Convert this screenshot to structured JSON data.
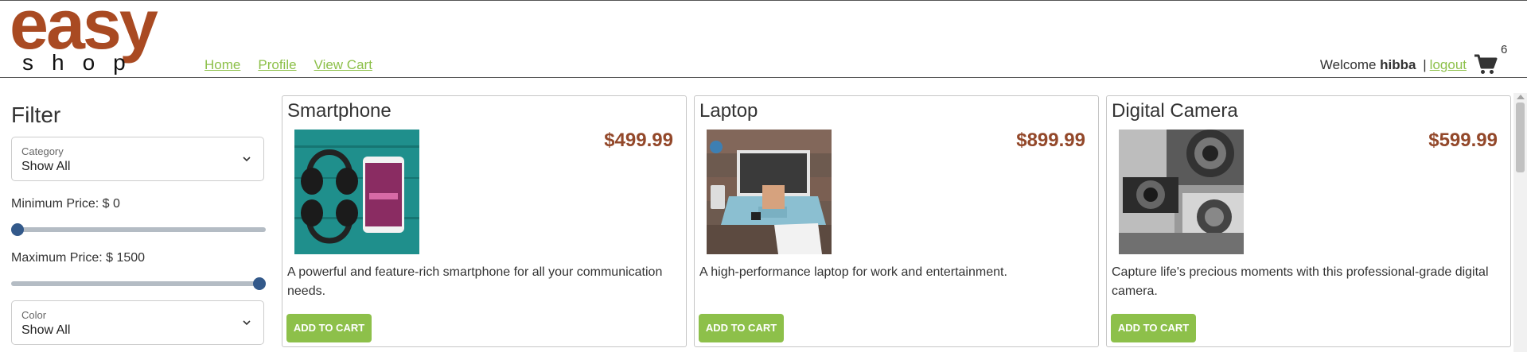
{
  "logo": {
    "word1": "easy",
    "word2": "shop"
  },
  "nav": {
    "home": "Home",
    "profile": "Profile",
    "view_cart": "View Cart"
  },
  "user": {
    "welcome": "Welcome",
    "name": "hibba",
    "separator": "|",
    "logout": "logout"
  },
  "cart": {
    "count": "6",
    "icon": "shopping-cart-icon"
  },
  "filter": {
    "title": "Filter",
    "category": {
      "label": "Category",
      "value": "Show All"
    },
    "min_price": {
      "label": "Minimum Price: $ 0",
      "fraction": 0.0
    },
    "max_price": {
      "label": "Maximum Price: $ 1500",
      "fraction": 1.0
    },
    "color": {
      "label": "Color",
      "value": "Show All"
    }
  },
  "products": [
    {
      "title": "Smartphone",
      "price": "$499.99",
      "description": "A powerful and feature-rich smartphone for all your communication needs.",
      "button": "ADD TO CART"
    },
    {
      "title": "Laptop",
      "price": "$899.99",
      "description": "A high-performance laptop for work and entertainment.",
      "button": "ADD TO CART"
    },
    {
      "title": "Digital Camera",
      "price": "$599.99",
      "description": "Capture life's precious moments with this professional-grade digital camera.",
      "button": "ADD TO CART"
    }
  ],
  "colors": {
    "brand": "#a94a22",
    "link": "#8dc04a",
    "price": "#93482a",
    "button": "#8dc04a",
    "slider_thumb": "#33598a"
  }
}
